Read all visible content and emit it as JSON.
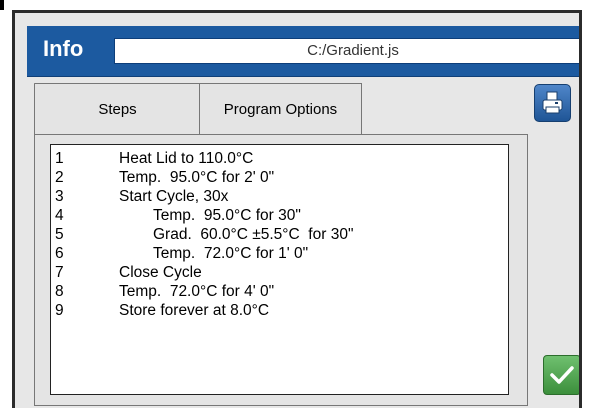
{
  "header": {
    "title": "Info",
    "file_path": "C:/Gradient.js"
  },
  "tabs": [
    {
      "label": "Steps",
      "active": true
    },
    {
      "label": "Program Options",
      "active": false
    }
  ],
  "steps": [
    {
      "number": "1",
      "text": "Heat Lid to 110.0°C",
      "indent": 0
    },
    {
      "number": "2",
      "text": "Temp.  95.0°C for 2' 0\"",
      "indent": 0
    },
    {
      "number": "3",
      "text": "Start Cycle, 30x",
      "indent": 0
    },
    {
      "number": "4",
      "text": "Temp.  95.0°C for 30\"",
      "indent": 1
    },
    {
      "number": "5",
      "text": "Grad.  60.0°C ±5.5°C  for 30\"",
      "indent": 1
    },
    {
      "number": "6",
      "text": "Temp.  72.0°C for 1' 0\"",
      "indent": 1
    },
    {
      "number": "7",
      "text": "Close Cycle",
      "indent": 0
    },
    {
      "number": "8",
      "text": "Temp.  72.0°C for 4' 0\"",
      "indent": 0
    },
    {
      "number": "9",
      "text": "Store forever at 8.0°C",
      "indent": 0
    }
  ],
  "buttons": {
    "print_icon": "printer-icon",
    "ok_icon": "checkmark-icon"
  },
  "colors": {
    "header_blue": "#1c5aa0",
    "ok_green": "#4ea84e"
  }
}
